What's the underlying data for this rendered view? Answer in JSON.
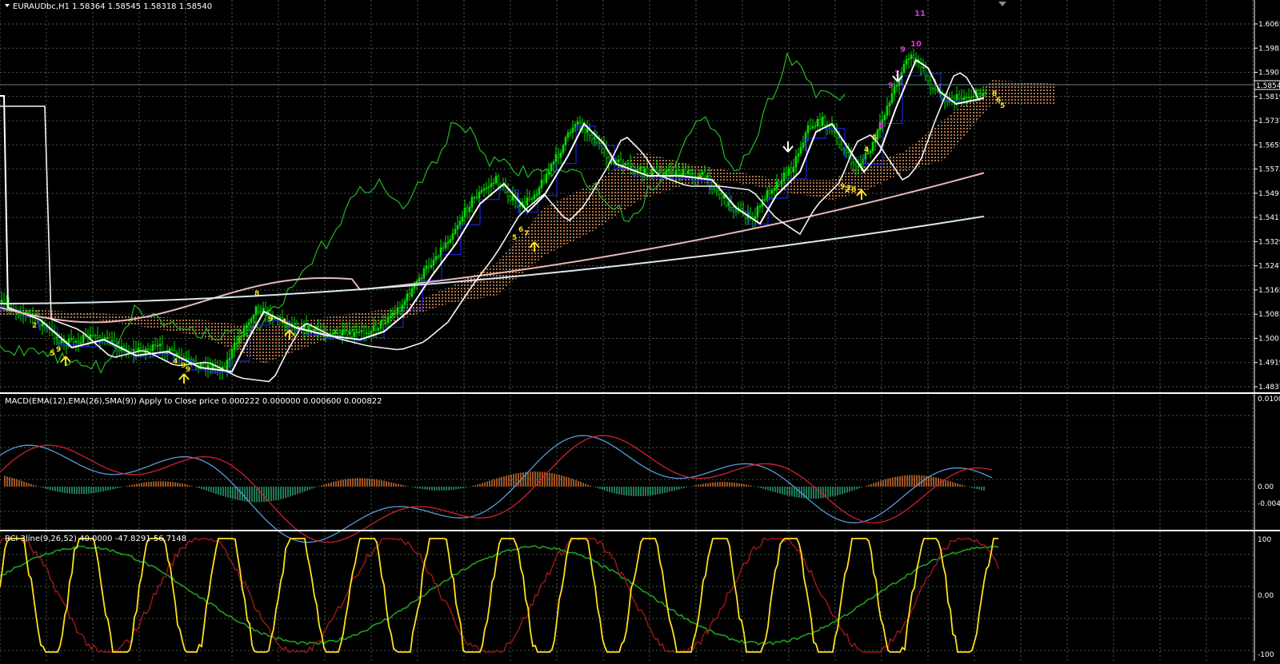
{
  "main_panel": {
    "title": "EURAUDbc,H1  1.58364 1.58545 1.58318 1.58540",
    "current_price": "1.58540",
    "price_ticks": [
      "1.60650",
      "1.59830",
      "1.59010",
      "1.58190",
      "1.57370",
      "1.56550",
      "1.55730",
      "1.54910",
      "1.54110",
      "1.53290",
      "1.52470",
      "1.51650",
      "1.50830",
      "1.50010",
      "1.49190",
      "1.48370"
    ],
    "ylim": [
      1.4837,
      1.6085
    ],
    "count_labels": [
      "9",
      "5",
      "2",
      "4",
      "9",
      "9",
      "8",
      "9",
      "4",
      "5",
      "6",
      "7",
      "2",
      "8",
      "7",
      "9",
      "2",
      "4",
      "5",
      "8",
      "9",
      "7",
      "11",
      "10",
      "9",
      "8",
      "6",
      "5"
    ]
  },
  "macd_panel": {
    "title": "MACD(EMA(12),EMA(26),SMA(9)) Apply to Close price 0.000222 0.000000 0.000600 0.000822",
    "ticks": [
      "0.01008",
      "0.00",
      "-0.0048"
    ]
  },
  "rci_panel": {
    "title": "RCI 3line(9,26,52) 40.0000 -47.8291 56.7148",
    "ticks": [
      "100",
      "0.00",
      "-100"
    ]
  },
  "colors": {
    "background": "#000000",
    "grid": "#4a5a4a",
    "candle": "#00e000",
    "chikou": "#22b822",
    "kijun": "#2020e0",
    "ma_fast": "#ffffff",
    "ma_mid": "#e8b8b8",
    "ma_slow": "#d8e8f0",
    "kumo": "#c88050",
    "macd_main": "#5a9ad8",
    "macd_signal": "#d02030",
    "hist_pos": "#d07030",
    "hist_neg": "#2aa070",
    "rci_short": "#ffe020",
    "rci_mid": "#a01818",
    "rci_long": "#20a020",
    "signal_arrow": "#ffe020",
    "count_text": "#ffe020",
    "count_top": "#e030e0"
  },
  "icons": [
    "panel-collapse-icon",
    "buy-arrow-icon",
    "sell-arrow-icon"
  ]
}
